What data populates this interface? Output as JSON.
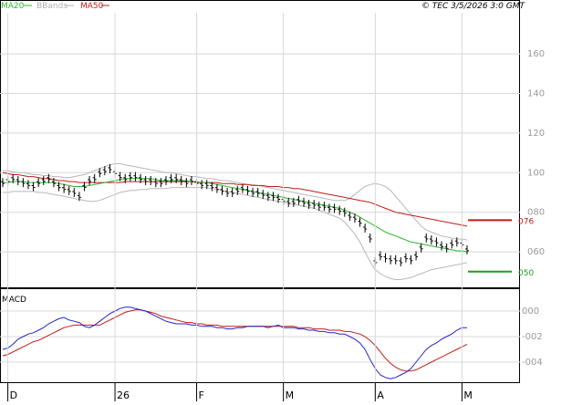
{
  "header": {
    "legend": [
      {
        "label": "MA20",
        "color": "#2db82d"
      },
      {
        "label": "BBands",
        "color": "#b0b0b0"
      },
      {
        "label": "MA50",
        "color": "#c21b1b"
      }
    ],
    "copyright": "© TEC 3/5/2026 3:0 GMT"
  },
  "macd_label": "MACD",
  "chart_data": [
    {
      "type": "line",
      "title": "",
      "ylim": [
        0.43,
        1.78
      ],
      "y_ticks": [
        {
          "label": "160",
          "value": 1.6
        },
        {
          "label": "140",
          "value": 1.4
        },
        {
          "label": "120",
          "value": 1.2
        },
        {
          "label": "100",
          "value": 1.0
        },
        {
          "label": "080",
          "value": 0.8
        },
        {
          "label": "060",
          "value": 0.6
        }
      ],
      "x_ticks": [
        {
          "label": "D",
          "index": 1
        },
        {
          "label": "26",
          "index": 22
        },
        {
          "label": "F",
          "index": 38
        },
        {
          "label": "M",
          "index": 55
        },
        {
          "label": "A",
          "index": 73
        },
        {
          "label": "M",
          "index": 90
        }
      ],
      "grid": true,
      "marker_lines": [
        {
          "label": "076",
          "value": 0.76,
          "color": "#c21b1b"
        },
        {
          "label": "050",
          "value": 0.5,
          "color": "#1d9e1d"
        }
      ],
      "price_color": "#000000",
      "series": [
        {
          "name": "Price",
          "values": [
            0.95,
            0.96,
            0.97,
            0.96,
            0.95,
            0.94,
            0.93,
            0.95,
            0.96,
            0.97,
            0.95,
            0.93,
            0.92,
            0.91,
            0.9,
            0.88,
            0.93,
            0.96,
            0.97,
            1.0,
            1.01,
            1.02,
            1.0,
            0.98,
            0.97,
            0.98,
            0.98,
            0.97,
            0.96,
            0.96,
            0.95,
            0.95,
            0.96,
            0.97,
            0.97,
            0.96,
            0.95,
            0.96,
            0.95,
            0.94,
            0.94,
            0.93,
            0.92,
            0.91,
            0.9,
            0.9,
            0.91,
            0.92,
            0.91,
            0.9,
            0.9,
            0.89,
            0.88,
            0.88,
            0.87,
            0.86,
            0.85,
            0.85,
            0.86,
            0.85,
            0.84,
            0.84,
            0.83,
            0.83,
            0.82,
            0.82,
            0.81,
            0.8,
            0.78,
            0.77,
            0.75,
            0.72,
            0.67,
            0.55,
            0.58,
            0.57,
            0.56,
            0.56,
            0.55,
            0.57,
            0.56,
            0.58,
            0.62,
            0.67,
            0.66,
            0.65,
            0.63,
            0.62,
            0.64,
            0.65,
            0.64,
            0.61
          ]
        },
        {
          "name": "MA20",
          "values": [
            0.95,
            0.95,
            0.955,
            0.955,
            0.955,
            0.95,
            0.95,
            0.95,
            0.95,
            0.95,
            0.95,
            0.945,
            0.94,
            0.935,
            0.93,
            0.93,
            0.93,
            0.935,
            0.94,
            0.945,
            0.95,
            0.955,
            0.96,
            0.965,
            0.97,
            0.97,
            0.97,
            0.97,
            0.97,
            0.97,
            0.965,
            0.96,
            0.96,
            0.96,
            0.96,
            0.96,
            0.96,
            0.955,
            0.955,
            0.95,
            0.95,
            0.945,
            0.94,
            0.935,
            0.93,
            0.925,
            0.92,
            0.915,
            0.91,
            0.905,
            0.9,
            0.895,
            0.89,
            0.885,
            0.88,
            0.875,
            0.87,
            0.865,
            0.86,
            0.855,
            0.85,
            0.845,
            0.84,
            0.835,
            0.83,
            0.825,
            0.82,
            0.81,
            0.8,
            0.79,
            0.775,
            0.76,
            0.745,
            0.73,
            0.715,
            0.7,
            0.69,
            0.68,
            0.67,
            0.66,
            0.65,
            0.645,
            0.64,
            0.635,
            0.63,
            0.625,
            0.62,
            0.615,
            0.61,
            0.605,
            0.605,
            0.6
          ]
        },
        {
          "name": "MA50",
          "values": [
            1.0,
            0.995,
            0.99,
            0.99,
            0.985,
            0.98,
            0.98,
            0.975,
            0.97,
            0.97,
            0.965,
            0.96,
            0.96,
            0.955,
            0.955,
            0.95,
            0.95,
            0.95,
            0.95,
            0.95,
            0.95,
            0.95,
            0.95,
            0.95,
            0.955,
            0.955,
            0.955,
            0.955,
            0.955,
            0.955,
            0.955,
            0.955,
            0.955,
            0.955,
            0.955,
            0.955,
            0.955,
            0.955,
            0.95,
            0.95,
            0.95,
            0.95,
            0.95,
            0.945,
            0.945,
            0.945,
            0.94,
            0.94,
            0.94,
            0.935,
            0.935,
            0.935,
            0.93,
            0.93,
            0.93,
            0.925,
            0.925,
            0.92,
            0.92,
            0.915,
            0.91,
            0.905,
            0.9,
            0.895,
            0.89,
            0.885,
            0.88,
            0.875,
            0.87,
            0.865,
            0.86,
            0.855,
            0.85,
            0.84,
            0.83,
            0.82,
            0.81,
            0.8,
            0.795,
            0.79,
            0.785,
            0.78,
            0.775,
            0.77,
            0.765,
            0.76,
            0.755,
            0.75,
            0.745,
            0.74,
            0.735,
            0.73
          ]
        },
        {
          "name": "BBands Upper",
          "values": [
            1.01,
            1.01,
            1.005,
            1.0,
            1.0,
            0.995,
            0.99,
            0.99,
            0.985,
            0.985,
            0.98,
            0.98,
            0.975,
            0.975,
            0.98,
            0.985,
            0.99,
            1.0,
            1.01,
            1.02,
            1.03,
            1.04,
            1.045,
            1.045,
            1.04,
            1.035,
            1.03,
            1.025,
            1.02,
            1.015,
            1.01,
            1.005,
            1.0,
            1.0,
            0.995,
            0.99,
            0.985,
            0.98,
            0.98,
            0.975,
            0.97,
            0.97,
            0.965,
            0.96,
            0.96,
            0.955,
            0.95,
            0.945,
            0.94,
            0.94,
            0.935,
            0.93,
            0.925,
            0.92,
            0.915,
            0.91,
            0.905,
            0.9,
            0.895,
            0.89,
            0.885,
            0.88,
            0.875,
            0.87,
            0.865,
            0.86,
            0.86,
            0.86,
            0.87,
            0.89,
            0.91,
            0.93,
            0.94,
            0.945,
            0.94,
            0.93,
            0.91,
            0.88,
            0.85,
            0.82,
            0.79,
            0.76,
            0.73,
            0.71,
            0.7,
            0.69,
            0.68,
            0.675,
            0.67,
            0.665,
            0.665,
            0.66
          ]
        },
        {
          "name": "BBands Lower",
          "values": [
            0.9,
            0.9,
            0.905,
            0.905,
            0.905,
            0.905,
            0.905,
            0.9,
            0.9,
            0.895,
            0.89,
            0.885,
            0.88,
            0.875,
            0.87,
            0.865,
            0.86,
            0.855,
            0.855,
            0.86,
            0.87,
            0.88,
            0.89,
            0.9,
            0.905,
            0.91,
            0.91,
            0.915,
            0.915,
            0.92,
            0.92,
            0.92,
            0.92,
            0.925,
            0.925,
            0.925,
            0.925,
            0.925,
            0.925,
            0.925,
            0.925,
            0.92,
            0.915,
            0.91,
            0.905,
            0.9,
            0.895,
            0.89,
            0.885,
            0.88,
            0.875,
            0.87,
            0.865,
            0.86,
            0.855,
            0.85,
            0.845,
            0.84,
            0.835,
            0.83,
            0.825,
            0.82,
            0.81,
            0.8,
            0.79,
            0.78,
            0.77,
            0.75,
            0.72,
            0.69,
            0.65,
            0.6,
            0.55,
            0.51,
            0.49,
            0.475,
            0.465,
            0.46,
            0.46,
            0.465,
            0.47,
            0.48,
            0.49,
            0.5,
            0.51,
            0.515,
            0.52,
            0.525,
            0.53,
            0.535,
            0.54,
            0.545
          ]
        }
      ]
    },
    {
      "type": "line",
      "title": "MACD",
      "ylim": [
        -0.0055,
        0.0015
      ],
      "y_ticks": [
        {
          "label": "000",
          "value": 0.0
        },
        {
          "label": "-002",
          "value": -0.002
        },
        {
          "label": "-004",
          "value": -0.004
        }
      ],
      "grid": true,
      "series": [
        {
          "name": "MACD",
          "color": "#2323c8",
          "values": [
            -0.003,
            -0.0029,
            -0.0026,
            -0.0022,
            -0.002,
            -0.0018,
            -0.0017,
            -0.0015,
            -0.0013,
            -0.001,
            -0.0008,
            -0.0006,
            -0.0005,
            -0.0007,
            -0.0008,
            -0.0009,
            -0.0012,
            -0.0013,
            -0.0011,
            -0.0008,
            -0.0005,
            -0.0002,
            0.0,
            0.0002,
            0.0003,
            0.0003,
            0.0002,
            0.0001,
            0.0,
            -0.0002,
            -0.0004,
            -0.0006,
            -0.0008,
            -0.0009,
            -0.001,
            -0.001,
            -0.001,
            -0.0011,
            -0.0011,
            -0.0012,
            -0.0012,
            -0.0012,
            -0.0013,
            -0.0013,
            -0.0014,
            -0.0014,
            -0.0013,
            -0.0013,
            -0.0012,
            -0.0012,
            -0.0012,
            -0.0012,
            -0.0013,
            -0.0012,
            -0.0011,
            -0.0013,
            -0.0013,
            -0.0013,
            -0.0014,
            -0.0014,
            -0.0015,
            -0.0015,
            -0.0016,
            -0.0016,
            -0.0017,
            -0.0017,
            -0.0018,
            -0.0018,
            -0.002,
            -0.0022,
            -0.0025,
            -0.003,
            -0.0038,
            -0.0045,
            -0.005,
            -0.0052,
            -0.0053,
            -0.0052,
            -0.005,
            -0.0048,
            -0.0045,
            -0.004,
            -0.0035,
            -0.003,
            -0.0027,
            -0.0025,
            -0.0022,
            -0.002,
            -0.0018,
            -0.0015,
            -0.0013,
            -0.0013
          ]
        },
        {
          "name": "Signal",
          "color": "#c21b1b",
          "values": [
            -0.0035,
            -0.0034,
            -0.0032,
            -0.003,
            -0.0028,
            -0.0026,
            -0.0024,
            -0.0023,
            -0.0021,
            -0.0019,
            -0.0017,
            -0.0015,
            -0.0013,
            -0.0012,
            -0.0011,
            -0.0011,
            -0.0011,
            -0.0011,
            -0.0011,
            -0.0011,
            -0.0009,
            -0.0007,
            -0.0005,
            -0.0003,
            -0.0001,
            0.0,
            0.0001,
            0.0001,
            0.0,
            -0.0001,
            -0.0002,
            -0.0004,
            -0.0005,
            -0.0006,
            -0.0007,
            -0.0008,
            -0.0009,
            -0.0009,
            -0.001,
            -0.001,
            -0.0011,
            -0.0011,
            -0.0011,
            -0.0012,
            -0.0012,
            -0.0012,
            -0.0012,
            -0.0012,
            -0.0012,
            -0.0012,
            -0.0012,
            -0.0012,
            -0.0012,
            -0.0012,
            -0.0012,
            -0.0012,
            -0.0012,
            -0.0012,
            -0.0013,
            -0.0013,
            -0.0013,
            -0.0014,
            -0.0014,
            -0.0014,
            -0.0015,
            -0.0015,
            -0.0015,
            -0.0016,
            -0.0016,
            -0.0017,
            -0.0018,
            -0.002,
            -0.0023,
            -0.0027,
            -0.0032,
            -0.0037,
            -0.0041,
            -0.0044,
            -0.0046,
            -0.0047,
            -0.0047,
            -0.0046,
            -0.0044,
            -0.0042,
            -0.004,
            -0.0038,
            -0.0036,
            -0.0034,
            -0.0032,
            -0.003,
            -0.0028,
            -0.0026
          ]
        }
      ]
    }
  ]
}
